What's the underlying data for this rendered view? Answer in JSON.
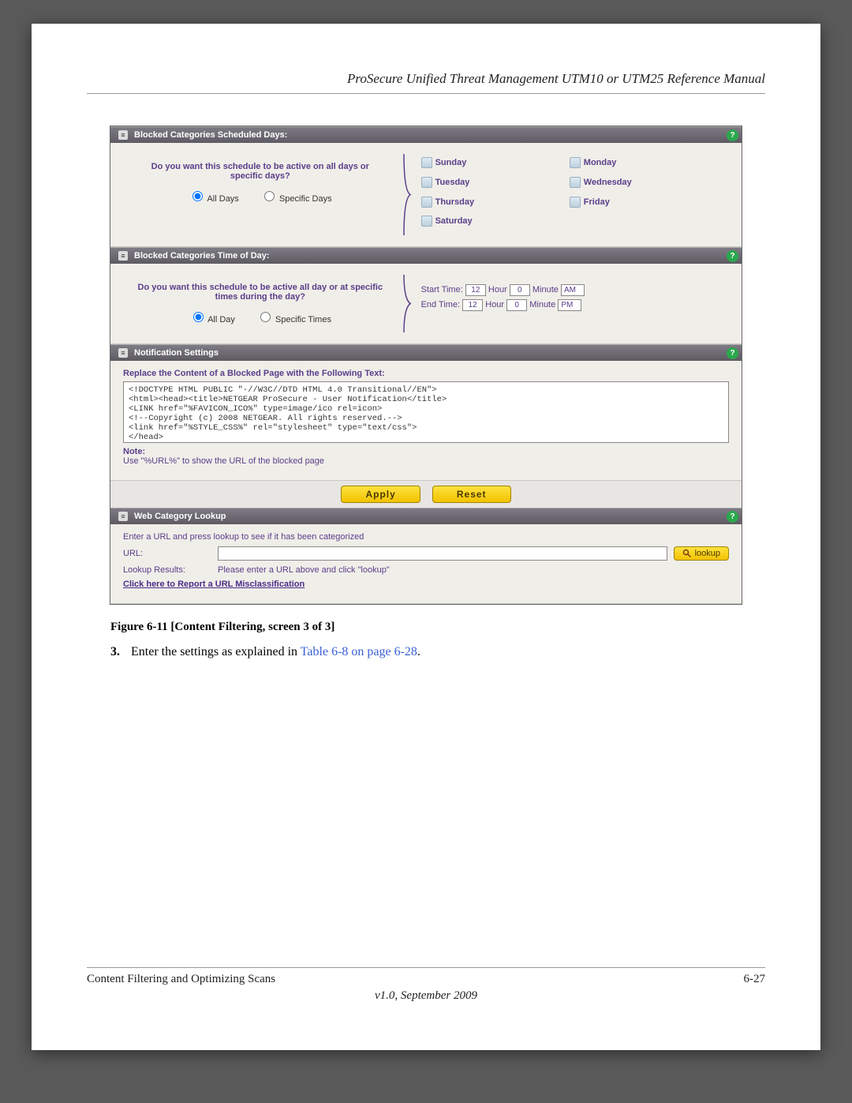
{
  "doc": {
    "header": "ProSecure Unified Threat Management UTM10 or UTM25 Reference Manual",
    "footer_left": "Content Filtering and Optimizing Scans",
    "footer_right": "6-27",
    "version": "v1.0, September 2009"
  },
  "figure_caption": "Figure 6-11 [Content Filtering, screen 3 of 3]",
  "step": {
    "num": "3.",
    "text_before": "Enter the settings as explained in ",
    "link": "Table 6-8 on page 6-28",
    "text_after": "."
  },
  "panels": {
    "scheduled_days": {
      "title": "Blocked Categories Scheduled Days:",
      "question": "Do you want this schedule to be active on all days or specific days?",
      "radio_all": "All Days",
      "radio_specific": "Specific Days",
      "days": [
        "Sunday",
        "Monday",
        "Tuesday",
        "Wednesday",
        "Thursday",
        "Friday",
        "Saturday"
      ]
    },
    "time_of_day": {
      "title": "Blocked Categories Time of Day:",
      "question": "Do you want this schedule to be active all day or at specific times during the day?",
      "radio_all": "All Day",
      "radio_specific": "Specific Times",
      "start_label": "Start Time:",
      "end_label": "End Time:",
      "hour_label": "Hour",
      "minute_label": "Minute",
      "start_hour": "12",
      "start_minute": "0",
      "start_ampm": "AM",
      "end_hour": "12",
      "end_minute": "0",
      "end_ampm": "PM"
    },
    "notification": {
      "title": "Notification Settings",
      "heading": "Replace the Content of a Blocked Page with the Following Text:",
      "textarea": "<!DOCTYPE HTML PUBLIC \"-//W3C//DTD HTML 4.0 Transitional//EN\">\n<html><head><title>NETGEAR ProSecure - User Notification</title>\n<LINK href=\"%FAVICON_ICO%\" type=image/ico rel=icon>\n<!--Copyright (c) 2008 NETGEAR. All rights reserved.-->\n<link href=\"%STYLE_CSS%\" rel=\"stylesheet\" type=\"text/css\">\n</head>",
      "note_label": "Note:",
      "note_desc": "Use \"%URL%\" to show the URL of the blocked page"
    },
    "buttons": {
      "apply": "Apply",
      "reset": "Reset"
    },
    "lookup": {
      "title": "Web Category Lookup",
      "instruction": "Enter a URL and press lookup to see if it has been categorized",
      "url_label": "URL:",
      "lookup_btn": "lookup",
      "results_label": "Lookup Results:",
      "results_value": "Please enter a URL above and click \"lookup\"",
      "report_link": "Click here to Report a URL Misclassification"
    }
  }
}
